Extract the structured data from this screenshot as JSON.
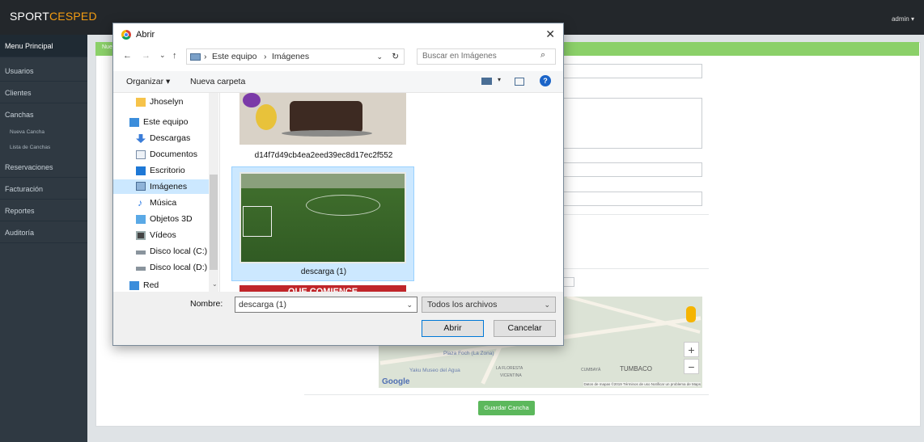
{
  "app": {
    "brand_part1": "SPORT",
    "brand_part2": "CESPED",
    "user_menu": "admin ▾"
  },
  "sidebar": {
    "items": [
      {
        "label": "Menu Principal"
      },
      {
        "label": "Usuarios"
      },
      {
        "label": "Clientes"
      },
      {
        "label": "Canchas"
      },
      {
        "label": "Reservaciones"
      },
      {
        "label": "Facturación"
      },
      {
        "label": "Reportes"
      },
      {
        "label": "Auditoría"
      }
    ],
    "subitems": [
      {
        "label": "Nueva Cancha"
      },
      {
        "label": "Lista de Canchas"
      }
    ]
  },
  "page": {
    "breadcrumb_fragment": "Nue",
    "save_button": "Guardar Cancha"
  },
  "map": {
    "labels": [
      "Plaza Foch (La Zona)",
      "Yaku Museo del Agua",
      "LA FLORESTA",
      "VICENTINA",
      "CUMBAYÁ",
      "TUMBACO"
    ],
    "brand": "Google",
    "footer": "Datos de mapas ©2019   Términos de uso   Notificar un problema de Maps",
    "zoom_in": "+",
    "zoom_out": "−"
  },
  "dialog": {
    "title": "Abrir",
    "close": "✕",
    "nav_back": "←",
    "nav_forward": "→",
    "nav_recent": "⌄",
    "nav_up": "↑",
    "path": [
      "Este equipo",
      "Imágenes"
    ],
    "path_sep": "›",
    "refresh": "↻",
    "search_placeholder": "Buscar en Imágenes",
    "toolbar": {
      "organize": "Organizar ▾",
      "new_folder": "Nueva carpeta",
      "help": "?"
    },
    "nav_items": [
      {
        "label": "Jhoselyn",
        "icon": "folder-icon"
      },
      {
        "label": "Este equipo",
        "icon": "computer-icon"
      },
      {
        "label": "Descargas",
        "icon": "download-icon"
      },
      {
        "label": "Documentos",
        "icon": "document-icon"
      },
      {
        "label": "Escritorio",
        "icon": "desktop-icon"
      },
      {
        "label": "Imágenes",
        "icon": "pictures-icon",
        "selected": true
      },
      {
        "label": "Música",
        "icon": "music-icon"
      },
      {
        "label": "Objetos 3D",
        "icon": "3d-objects-icon"
      },
      {
        "label": "Vídeos",
        "icon": "video-icon"
      },
      {
        "label": "Disco local (C:)",
        "icon": "drive-c-icon"
      },
      {
        "label": "Disco local (D:)",
        "icon": "drive-icon"
      },
      {
        "label": "Red",
        "icon": "network-icon"
      }
    ],
    "files": [
      {
        "name": "d14f7d49cb4ea2eed39ec8d17ec2f552"
      },
      {
        "name": "descarga (1)",
        "selected": true
      },
      {
        "name": "QUE COMIENCE"
      }
    ],
    "filename_label": "Nombre:",
    "filename_value": "descarga (1)",
    "filetype": "Todos los archivos",
    "open_button": "Abrir",
    "cancel_button": "Cancelar"
  }
}
